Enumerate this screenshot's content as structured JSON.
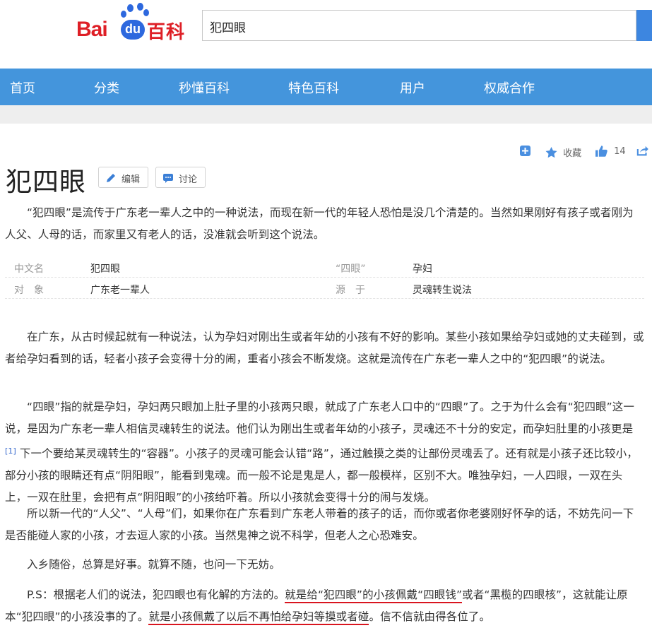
{
  "header": {
    "logo_bai": "Bai",
    "logo_du": "du",
    "logo_baike": "百科",
    "search_value": "犯四眼"
  },
  "nav": {
    "items": [
      "首页",
      "分类",
      "秒懂百科",
      "特色百科",
      "用户",
      "权威合作"
    ]
  },
  "colors": {
    "nav_bg": "#4495dc",
    "logo_red": "#de1f26",
    "logo_blue": "#2d68de",
    "annotation_red": "#d9151f",
    "link_blue": "#3366cc"
  },
  "tools": {
    "favorite_label": "收藏",
    "like_count": "14",
    "icons": [
      "add-icon",
      "star-icon",
      "thumbs-up-icon",
      "share-icon"
    ]
  },
  "entry": {
    "title": "犯四眼",
    "edit_label": "编辑",
    "discuss_label": "讨论",
    "summary": "“犯四眼”是流传于广东老一辈人之中的一种说法，而现在新一代的年轻人恐怕是没几个清楚的。当然如果刚好有孩子或者刚为人父、人母的话，而家里又有老人的话，没准就会听到这个说法。"
  },
  "infobox": [
    {
      "key": "中文名",
      "value": "犯四眼",
      "key2": "“四眼”",
      "value2": "孕妇"
    },
    {
      "key": "对　象",
      "value": "广东老一辈人",
      "key2": "源　于",
      "value2": "灵魂转生说法"
    }
  ],
  "body": {
    "p1": "在广东，从古时候起就有一种说法，认为孕妇对刚出生或者年幼的小孩有不好的影响。某些小孩如果给孕妇或她的丈夫碰到，或者给孕妇看到的话，轻者小孩子会变得十分的闹，重者小孩会不断发烧。这就是流传在广东老一辈人之中的“犯四眼”的说法。",
    "p2_a": "“四眼”指的就是孕妇，孕妇两只眼加上肚子里的小孩两只眼，就成了广东老人口中的“四眼”了。之于为什么会有“犯四眼”这一说，是因为广东老一辈人相信灵魂转生的说法。他们认为刚出生或者年幼的小孩子，灵魂还不十分的安定，而孕妇肚里的小孩更是 ",
    "p2_ref": "[1]",
    "p2_b": " 下一个要给某灵魂转生的“容器”。小孩子的灵魂可能会认错“路”，通过触摸之类的让部份灵魂丢了。还有就是小孩子还比较小，部分小孩的眼睛还有点“阴阳眼”，能看到鬼魂。而一般不论是鬼是人，都一般模样，区别不大。唯独孕妇，一人四眼，一双在头上，一双在肚里，会把有点“阴阳眼”的小孩给吓着。所以小孩就会变得十分的闹与发烧。",
    "p3": "所以新一代的“人父”、“人母”们，如果你在广东看到广东老人带着的孩子的话，而你或者你老婆刚好怀孕的话，不妨先问一下是否能碰人家的小孩，才去逗人家的小孩。当然鬼神之说不科学，但老人之心恐难安。",
    "p4": "入乡随俗，总算是好事。就算不随，也问一下无妨。",
    "p5_a": "P.S：根据老人们的说法，犯四眼也有化解的方法的。",
    "p5_b": "就是给“犯四眼”的小孩佩戴“四眼钱”",
    "p5_c": "或者“黑榄的四眼核”，这就能让原本“犯四眼”的小孩没事的了。",
    "p5_d": "就是小孩佩戴了以后不再怕给孕妇等摸或者碰",
    "p5_e": "。信不信就由得各位了。"
  }
}
